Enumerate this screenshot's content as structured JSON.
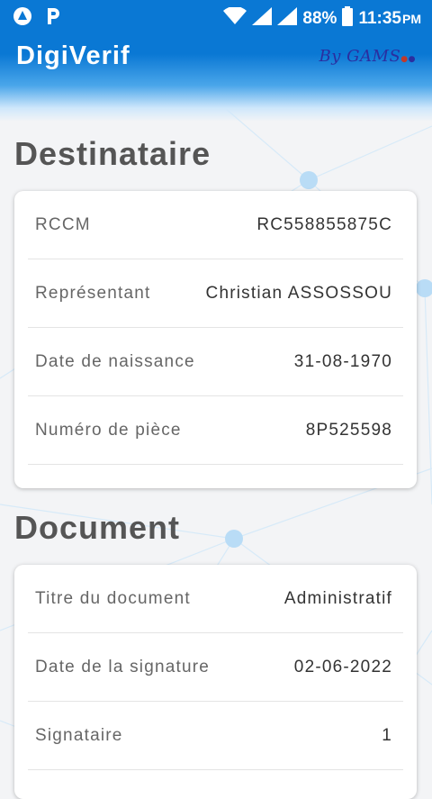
{
  "status_bar": {
    "battery": "88%",
    "time": "11:35",
    "ampm": "PM"
  },
  "header": {
    "title": "DigiVerif",
    "brand": "By GAMS"
  },
  "sections": {
    "destinataire": {
      "title": "Destinataire",
      "rows": [
        {
          "label": "RCCM",
          "value": "RC558855875C"
        },
        {
          "label": "Représentant",
          "value": "Christian ASSOSSOU"
        },
        {
          "label": "Date de naissance",
          "value": "31-08-1970"
        },
        {
          "label": "Numéro de pièce",
          "value": "8P525598"
        }
      ]
    },
    "document": {
      "title": "Document",
      "rows": [
        {
          "label": "Titre du document",
          "value": "Administratif"
        },
        {
          "label": "Date de la signature",
          "value": "02-06-2022"
        },
        {
          "label": "Signataire",
          "value": "1"
        }
      ]
    }
  }
}
